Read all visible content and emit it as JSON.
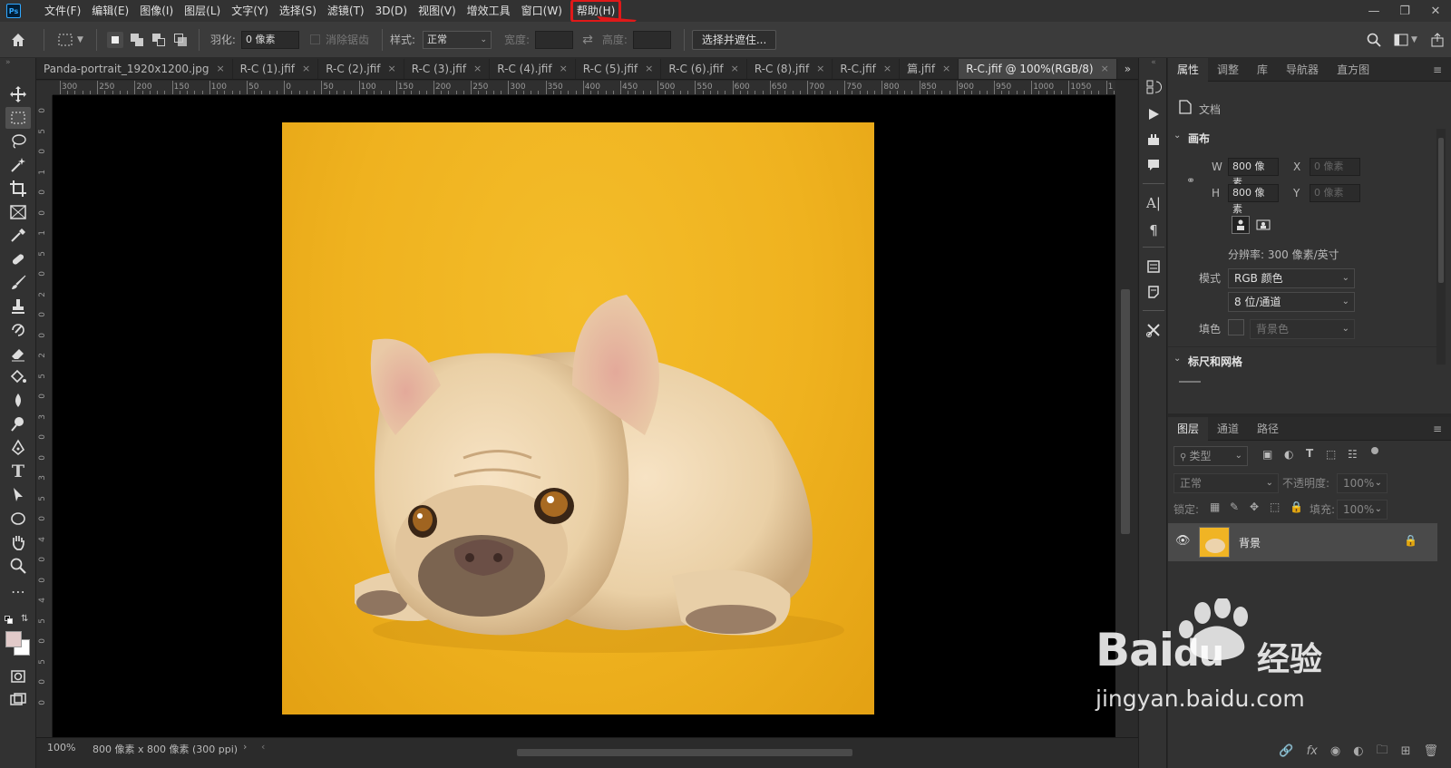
{
  "menubar": {
    "logo": "Ps",
    "items": [
      "文件(F)",
      "编辑(E)",
      "图像(I)",
      "图层(L)",
      "文字(Y)",
      "选择(S)",
      "滤镜(T)",
      "3D(D)",
      "视图(V)",
      "增效工具",
      "窗口(W)",
      "帮助(H)"
    ],
    "highlighted_item": "帮助(H)",
    "annotation_color": "#e01919"
  },
  "optionsbar": {
    "feather_label": "羽化:",
    "feather_value": "0 像素",
    "antialias_label": "消除锯齿",
    "style_label": "样式:",
    "style_value": "正常",
    "width_label": "宽度:",
    "height_label": "高度:",
    "select_mask_button": "选择并遮住..."
  },
  "tabs": [
    {
      "label": "Panda-portrait_1920x1200.jpg",
      "active": false
    },
    {
      "label": "R-C (1).jfif",
      "active": false
    },
    {
      "label": "R-C (2).jfif",
      "active": false
    },
    {
      "label": "R-C (3).jfif",
      "active": false
    },
    {
      "label": "R-C (4).jfif",
      "active": false
    },
    {
      "label": "R-C (5).jfif",
      "active": false
    },
    {
      "label": "R-C (6).jfif",
      "active": false
    },
    {
      "label": "R-C (8).jfif",
      "active": false
    },
    {
      "label": "R-C.jfif",
      "active": false
    },
    {
      "label": "篇.jfif",
      "active": false
    },
    {
      "label": "R-C.jfif @ 100%(RGB/8)",
      "active": true
    }
  ],
  "tab_close_glyph": "×",
  "ruler": {
    "top_labels": [
      "300",
      "250",
      "200",
      "150",
      "100",
      "50",
      "0",
      "50",
      "100",
      "150",
      "200",
      "250",
      "300",
      "350",
      "400",
      "450",
      "500",
      "550",
      "600",
      "650",
      "700",
      "750",
      "800",
      "850",
      "900",
      "950",
      "1000",
      "1050",
      "1"
    ],
    "left_labels": [
      "0",
      "5",
      "0",
      "1",
      "0",
      "0",
      "1",
      "5",
      "0",
      "2",
      "0",
      "0",
      "2",
      "5",
      "0",
      "3",
      "0",
      "0",
      "3",
      "5",
      "0",
      "4",
      "0",
      "0",
      "4",
      "5",
      "0",
      "5",
      "0",
      "0"
    ]
  },
  "status": {
    "zoom": "100%",
    "doc_info": "800 像素 x 800 像素 (300 ppi)"
  },
  "properties": {
    "tabs": [
      "属性",
      "调整",
      "库",
      "导航器",
      "直方图"
    ],
    "doc_label": "文档",
    "canvas_section": "画布",
    "w_label": "W",
    "w_value": "800 像素",
    "h_label": "H",
    "h_value": "800 像素",
    "x_label": "X",
    "x_placeholder": "0 像素",
    "y_label": "Y",
    "y_placeholder": "0 像素",
    "resolution": "分辨率: 300 像素/英寸",
    "mode_label": "模式",
    "mode_value": "RGB 颜色",
    "depth_value": "8 位/通道",
    "fill_label": "填色",
    "fill_value": "背景色",
    "rulers_section": "标尺和网格"
  },
  "layers": {
    "tabs": [
      "图层",
      "通道",
      "路径"
    ],
    "filter_placeholder": "类型",
    "blend_mode": "正常",
    "opacity_label": "不透明度:",
    "opacity_value": "100%",
    "lock_label": "锁定:",
    "fill_label": "填充:",
    "fill_value": "100%",
    "layer_name": "背景"
  },
  "watermark": {
    "brand": "Bai",
    "brand2": "du",
    "cn": "经验",
    "url": "jingyan.baidu.com"
  },
  "colors": {
    "canvas_bg": "#000000",
    "photo_bg": "#f0b424",
    "accent_red": "#e01919"
  }
}
